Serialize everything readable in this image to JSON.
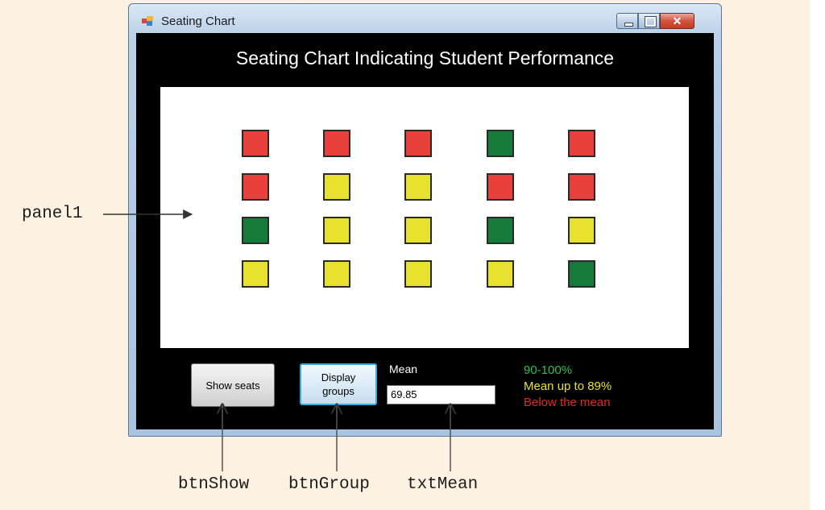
{
  "window": {
    "title": "Seating Chart",
    "close_glyph": "✕"
  },
  "form": {
    "heading": "Seating Chart Indicating Student Performance",
    "btn_show_label": "Show seats",
    "btn_group_label": "Display groups",
    "mean_label": "Mean",
    "mean_value": "69.85",
    "legend": [
      {
        "label": "90-100%",
        "color": "#2ec24a"
      },
      {
        "label": "Mean up to  89%",
        "color": "#e8e233"
      },
      {
        "label": "Below the mean",
        "color": "#e02a20"
      }
    ]
  },
  "seats": {
    "colors": {
      "red": "#e8403a",
      "yellow": "#e6e22f",
      "green": "#157a3a"
    },
    "rows": [
      [
        "red",
        "red",
        "red",
        "green",
        "red"
      ],
      [
        "red",
        "yellow",
        "yellow",
        "red",
        "red"
      ],
      [
        "green",
        "yellow",
        "yellow",
        "green",
        "yellow"
      ],
      [
        "yellow",
        "yellow",
        "yellow",
        "yellow",
        "green"
      ]
    ]
  },
  "annotations": {
    "panel": "panel1",
    "btn_show": "btnShow",
    "btn_group": "btnGroup",
    "txt_mean": "txtMean"
  }
}
